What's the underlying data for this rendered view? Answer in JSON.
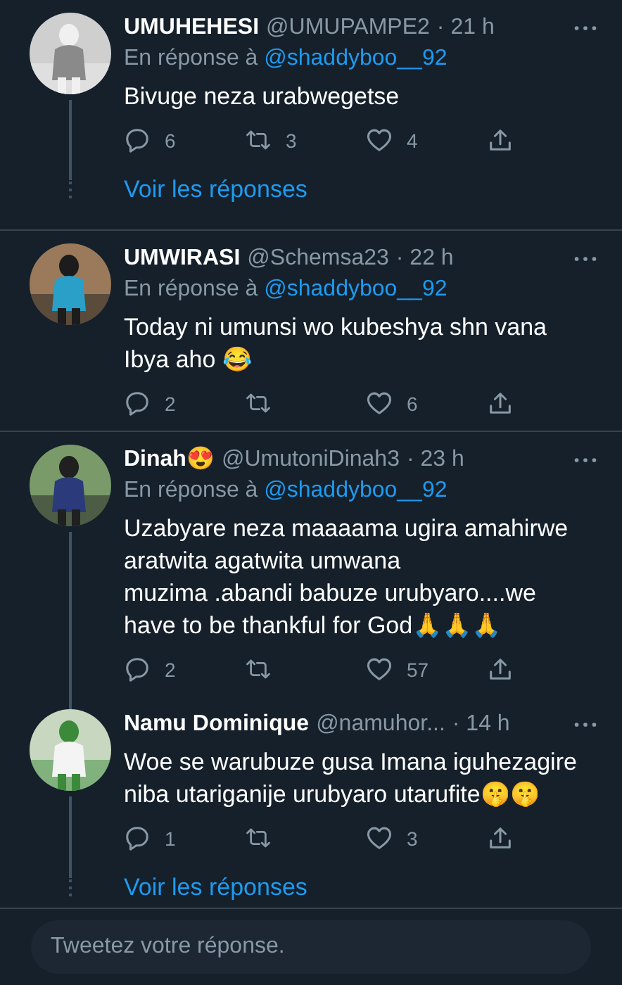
{
  "conversations": [
    {
      "tweets": [
        {
          "name": "UMUHEHESI",
          "handle": "@UMUPAMPE2",
          "time": "· 21 h",
          "reply_prefix": "En réponse à",
          "reply_to": "@shaddyboo__92",
          "text": "Bivuge neza urabwegetse",
          "replies": "6",
          "retweets": "3",
          "likes": "4"
        }
      ],
      "show_replies": "Voir les réponses"
    },
    {
      "tweets": [
        {
          "name": "UMWIRASI",
          "handle": "@Schemsa23",
          "time": "· 22 h",
          "reply_prefix": "En réponse à",
          "reply_to": "@shaddyboo__92",
          "text": "Today ni umunsi wo kubeshya shn vana Ibya aho 😂",
          "replies": "2",
          "likes": "6"
        }
      ]
    },
    {
      "tweets": [
        {
          "name": "Dinah😍",
          "handle": "@UmutoniDinah3",
          "time": "· 23 h",
          "reply_prefix": "En réponse à",
          "reply_to": "@shaddyboo__92",
          "text": "Uzabyare neza maaaama ugira amahirwe aratwita agatwita umwana\nmuzima .abandi babuze urubyaro....we have to be thankful for God🙏🙏🙏",
          "replies": "2",
          "likes": "57"
        },
        {
          "name": "Namu Dominique",
          "handle": "@namuhor...",
          "time": "· 14 h",
          "text": "Woe se warubuze gusa Imana iguhezagire niba utariganije urubyaro utarufite🤫🤫",
          "replies": "1",
          "likes": "3"
        }
      ],
      "show_replies": "Voir les réponses"
    }
  ],
  "compose": {
    "placeholder": "Tweetez votre réponse."
  }
}
